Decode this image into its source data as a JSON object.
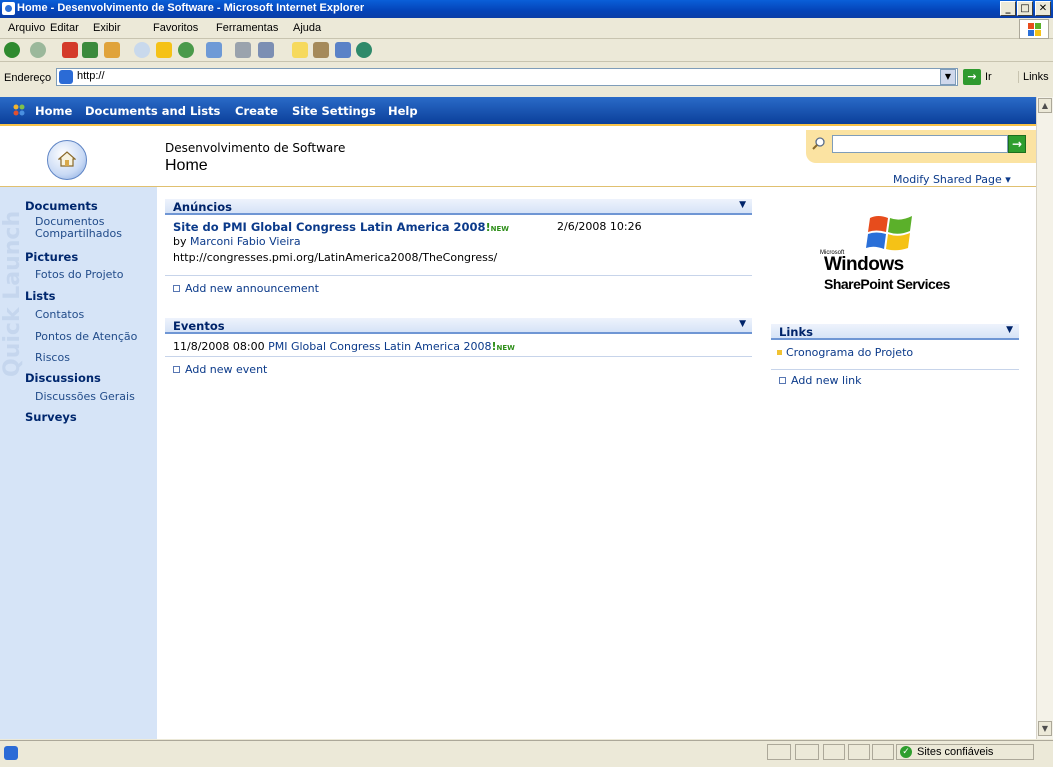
{
  "window": {
    "title": "Home - Desenvolvimento de Software - Microsoft Internet Explorer"
  },
  "menubar": [
    "Arquivo",
    "Editar",
    "Exibir",
    "Favoritos",
    "Ferramentas",
    "Ajuda"
  ],
  "address": {
    "label": "Endereço",
    "value": "http://",
    "go_label": "Ir",
    "links_label": "Links"
  },
  "topnav": [
    "Home",
    "Documents and Lists",
    "Create",
    "Site Settings",
    "Help"
  ],
  "header": {
    "site_name": "Desenvolvimento de Software",
    "page_title": "Home",
    "modify_label": "Modify Shared Page ▾",
    "search_value": ""
  },
  "quicklaunch": {
    "watermark": "Quick Launch",
    "documents": "Documents",
    "documents_items": [
      "Documentos Compartilhados"
    ],
    "pictures": "Pictures",
    "pictures_items": [
      "Fotos do Projeto"
    ],
    "lists": "Lists",
    "lists_items": [
      "Contatos",
      "Pontos de Atenção",
      "Riscos"
    ],
    "discussions": "Discussions",
    "discussions_items": [
      "Discussões Gerais"
    ],
    "surveys": "Surveys"
  },
  "announcements": {
    "title": "Anúncios",
    "item": {
      "title": "Site do PMI Global Congress Latin America 2008",
      "new": "NEW",
      "date": "2/6/2008 10:26",
      "by": "by",
      "author": "Marconi Fabio Vieira",
      "url": "http://congresses.pmi.org/LatinAmerica2008/TheCongress/"
    },
    "add_label": "Add new announcement"
  },
  "events": {
    "title": "Eventos",
    "item": {
      "date": "11/8/2008 08:00",
      "title": "PMI Global Congress Latin America 2008",
      "new": "NEW"
    },
    "add_label": "Add new event"
  },
  "logo": {
    "line1": "Microsoft",
    "line2": "Windows",
    "line3": "SharePoint Services"
  },
  "links": {
    "title": "Links",
    "items": [
      "Cronograma do Projeto"
    ],
    "add_label": "Add new link"
  },
  "statusbar": {
    "zone": "Sites confiáveis"
  }
}
